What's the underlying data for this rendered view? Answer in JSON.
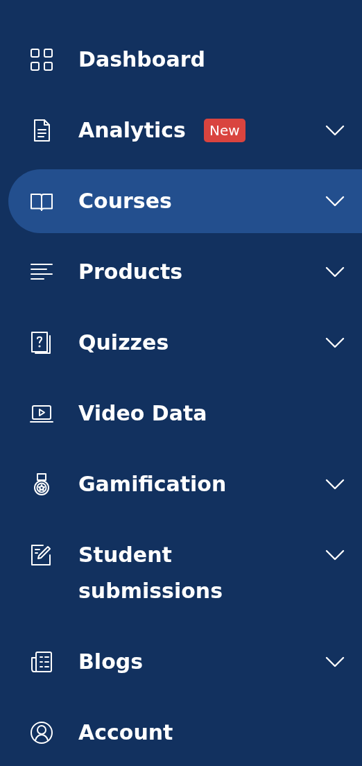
{
  "sidebar": {
    "items": [
      {
        "label": "Dashboard",
        "selected": false,
        "expandable": false
      },
      {
        "label": "Analytics",
        "selected": false,
        "expandable": true,
        "badge": "New"
      },
      {
        "label": "Courses",
        "selected": true,
        "expandable": true
      },
      {
        "label": "Products",
        "selected": false,
        "expandable": true
      },
      {
        "label": "Quizzes",
        "selected": false,
        "expandable": true
      },
      {
        "label": "Video Data",
        "selected": false,
        "expandable": false
      },
      {
        "label": "Gamification",
        "selected": false,
        "expandable": true
      },
      {
        "label": "Student submissions",
        "selected": false,
        "expandable": true
      },
      {
        "label": "Blogs",
        "selected": false,
        "expandable": true
      },
      {
        "label": "Account",
        "selected": false,
        "expandable": false
      }
    ]
  }
}
